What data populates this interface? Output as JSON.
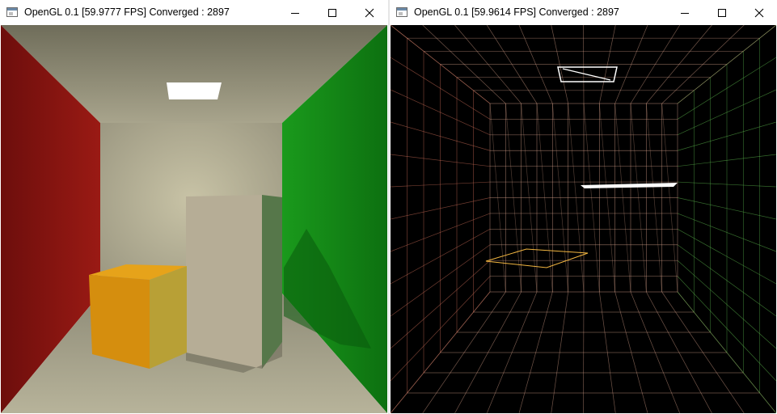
{
  "windows": [
    {
      "title": "OpenGL 0.1 [59.9777 FPS] Converged : 2897",
      "controls": {
        "minimize": "minimize-icon",
        "maximize": "maximize-icon",
        "close": "close-icon"
      },
      "view": "shaded"
    },
    {
      "title": "OpenGL 0.1 [59.9614 FPS] Converged : 2897",
      "controls": {
        "minimize": "minimize-icon",
        "maximize": "maximize-icon",
        "close": "close-icon"
      },
      "view": "wireframe"
    }
  ],
  "colors": {
    "left_wall": "#8a1512",
    "right_wall": "#138a18",
    "back_wall": "#b9b49c",
    "floor": "#a7a48c",
    "ceiling": "#8e8c74",
    "short_box": "#d99a12",
    "tall_box": "#b6ad96",
    "light": "#ffffff",
    "wire_background": "#000000",
    "wire_warm": "#e0a890",
    "wire_green": "#58b04a",
    "wire_light": "#ffcc44"
  }
}
